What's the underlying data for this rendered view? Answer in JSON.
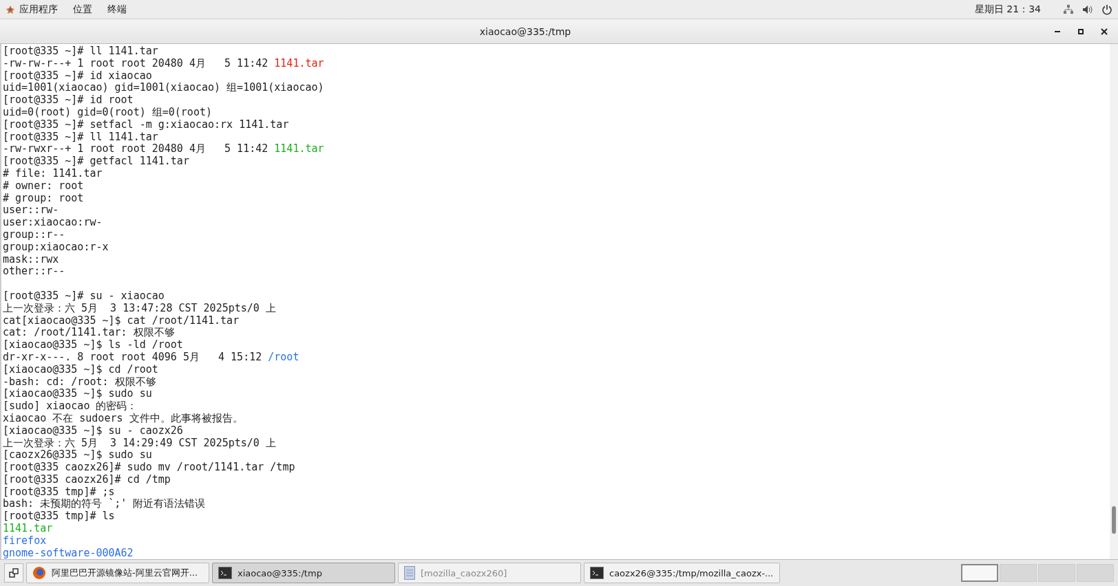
{
  "top_bar": {
    "menus": [
      {
        "label": "应用程序",
        "kind": "apps"
      },
      {
        "label": "位置",
        "kind": "plain"
      },
      {
        "label": "终端",
        "kind": "plain"
      }
    ],
    "clock": "星期日 21：34"
  },
  "window": {
    "title": "xiaocao@335:/tmp"
  },
  "terminal": {
    "lines": [
      {
        "segments": [
          {
            "text": "[root@335 ~]# ll 1141.tar",
            "kind": "plain"
          }
        ]
      },
      {
        "segments": [
          {
            "text": "-rw-rw-r--+ 1 root root 20480 4月   5 11:42 ",
            "kind": "plain"
          },
          {
            "text": "1141.tar",
            "kind": "archive"
          }
        ]
      },
      {
        "segments": [
          {
            "text": "[root@335 ~]# id xiaocao",
            "kind": "plain"
          }
        ]
      },
      {
        "segments": [
          {
            "text": "uid=1001(xiaocao) gid=1001(xiaocao) 组=1001(xiaocao)",
            "kind": "plain"
          }
        ]
      },
      {
        "segments": [
          {
            "text": "[root@335 ~]# id root",
            "kind": "plain"
          }
        ]
      },
      {
        "segments": [
          {
            "text": "uid=0(root) gid=0(root) 组=0(root)",
            "kind": "plain"
          }
        ]
      },
      {
        "segments": [
          {
            "text": "[root@335 ~]# setfacl -m g:xiaocao:rx 1141.tar",
            "kind": "plain"
          }
        ]
      },
      {
        "segments": [
          {
            "text": "[root@335 ~]# ll 1141.tar",
            "kind": "plain"
          }
        ]
      },
      {
        "segments": [
          {
            "text": "-rw-rwxr--+ 1 root root 20480 4月   5 11:42 ",
            "kind": "plain"
          },
          {
            "text": "1141.tar",
            "kind": "executable"
          }
        ]
      },
      {
        "segments": [
          {
            "text": "[root@335 ~]# getfacl 1141.tar",
            "kind": "plain"
          }
        ]
      },
      {
        "segments": [
          {
            "text": "# file: 1141.tar",
            "kind": "plain"
          }
        ]
      },
      {
        "segments": [
          {
            "text": "# owner: root",
            "kind": "plain"
          }
        ]
      },
      {
        "segments": [
          {
            "text": "# group: root",
            "kind": "plain"
          }
        ]
      },
      {
        "segments": [
          {
            "text": "user::rw-",
            "kind": "plain"
          }
        ]
      },
      {
        "segments": [
          {
            "text": "user:xiaocao:rw-",
            "kind": "plain"
          }
        ]
      },
      {
        "segments": [
          {
            "text": "group::r--",
            "kind": "plain"
          }
        ]
      },
      {
        "segments": [
          {
            "text": "group:xiaocao:r-x",
            "kind": "plain"
          }
        ]
      },
      {
        "segments": [
          {
            "text": "mask::rwx",
            "kind": "plain"
          }
        ]
      },
      {
        "segments": [
          {
            "text": "other::r--",
            "kind": "plain"
          }
        ]
      },
      {
        "kind": "blank"
      },
      {
        "segments": [
          {
            "text": "[root@335 ~]# su - xiaocao",
            "kind": "plain"
          }
        ]
      },
      {
        "segments": [
          {
            "text": "上一次登录：六 5月  3 13:47:28 CST 2025pts/0 上",
            "kind": "plain"
          }
        ]
      },
      {
        "segments": [
          {
            "text": "cat[xiaocao@335 ~]$ cat /root/1141.tar",
            "kind": "plain"
          }
        ]
      },
      {
        "segments": [
          {
            "text": "cat: /root/1141.tar: 权限不够",
            "kind": "plain"
          }
        ]
      },
      {
        "segments": [
          {
            "text": "[xiaocao@335 ~]$ ls -ld /root",
            "kind": "plain"
          }
        ]
      },
      {
        "segments": [
          {
            "text": "dr-xr-x---. 8 root root 4096 5月   4 15:12 ",
            "kind": "plain"
          },
          {
            "text": "/root",
            "kind": "directory"
          }
        ]
      },
      {
        "segments": [
          {
            "text": "[xiaocao@335 ~]$ cd /root",
            "kind": "plain"
          }
        ]
      },
      {
        "segments": [
          {
            "text": "-bash: cd: /root: 权限不够",
            "kind": "plain"
          }
        ]
      },
      {
        "segments": [
          {
            "text": "[xiaocao@335 ~]$ sudo su",
            "kind": "plain"
          }
        ]
      },
      {
        "segments": [
          {
            "text": "[sudo] xiaocao 的密码：",
            "kind": "plain"
          }
        ]
      },
      {
        "segments": [
          {
            "text": "xiaocao 不在 sudoers 文件中。此事将被报告。",
            "kind": "plain"
          }
        ]
      },
      {
        "segments": [
          {
            "text": "[xiaocao@335 ~]$ su - caozx26",
            "kind": "plain"
          }
        ]
      },
      {
        "segments": [
          {
            "text": "上一次登录：六 5月  3 14:29:49 CST 2025pts/0 上",
            "kind": "plain"
          }
        ]
      },
      {
        "segments": [
          {
            "text": "[caozx26@335 ~]$ sudo su",
            "kind": "plain"
          }
        ]
      },
      {
        "segments": [
          {
            "text": "[root@335 caozx26]# sudo mv /root/1141.tar /tmp",
            "kind": "plain"
          }
        ]
      },
      {
        "segments": [
          {
            "text": "[root@335 caozx26]# cd /tmp",
            "kind": "plain"
          }
        ]
      },
      {
        "segments": [
          {
            "text": "[root@335 tmp]# ;s",
            "kind": "plain"
          }
        ]
      },
      {
        "segments": [
          {
            "text": "bash: 未预期的符号 `;' 附近有语法错误",
            "kind": "plain"
          }
        ]
      },
      {
        "segments": [
          {
            "text": "[root@335 tmp]# ls",
            "kind": "plain"
          }
        ]
      },
      {
        "segments": [
          {
            "text": "1141.tar",
            "kind": "executable"
          }
        ]
      },
      {
        "segments": [
          {
            "text": "firefox",
            "kind": "directory"
          }
        ]
      },
      {
        "segments": [
          {
            "text": "gnome-software-000A62",
            "kind": "directory"
          }
        ]
      }
    ]
  },
  "taskbar": {
    "tasks": [
      {
        "label": "阿里巴巴开源镜像站-阿里云官网开...",
        "kind": "browser",
        "selected": false
      },
      {
        "label": "xiaocao@335:/tmp",
        "kind": "terminal",
        "selected": true
      },
      {
        "label": "[mozilla_caozx260]",
        "kind": "folder",
        "selected": false
      },
      {
        "label": "caozx26@335:/tmp/mozilla_caozx-...",
        "kind": "terminal",
        "selected": false
      }
    ],
    "workspaces": [
      {
        "selected": true
      },
      {
        "selected": false
      },
      {
        "selected": false
      },
      {
        "selected": false
      }
    ]
  }
}
